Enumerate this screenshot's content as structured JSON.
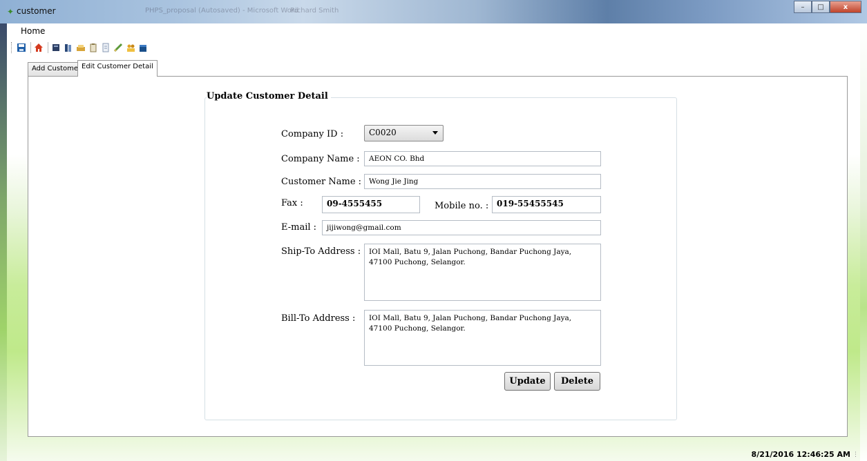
{
  "window": {
    "title": "customer",
    "blurred_taskbar_text": [
      "PHPS_proposal (Autosaved) - Microsoft Word",
      "Richard Smith"
    ],
    "buttons": {
      "minimize": "–",
      "maximize": "□",
      "close": "x"
    }
  },
  "menu": {
    "home": "Home"
  },
  "toolbar": {
    "icons": [
      "save-icon",
      "home-icon",
      "book-icon",
      "books-icon",
      "tray-icon",
      "clipboard-icon",
      "document-icon",
      "pen-icon",
      "users-icon",
      "box-icon"
    ]
  },
  "tabs": [
    {
      "label": "Add Customer",
      "active": false
    },
    {
      "label": "Edit Customer Detail",
      "active": true
    }
  ],
  "form": {
    "group_title": "Update Customer Detail",
    "company_id_label": "Company ID :",
    "company_id_value": "C0020",
    "company_name_label": "Company Name :",
    "company_name_value": "AEON CO. Bhd",
    "customer_name_label": "Customer Name :",
    "customer_name_value": "Wong Jie Jing",
    "fax_label": "Fax :",
    "fax_value": "09-4555455",
    "mobile_label": "Mobile no. :",
    "mobile_value": "019-55455545",
    "email_label": "E-mail :",
    "email_value": "jijiwong@gmail.com",
    "ship_label": "Ship-To Address :",
    "ship_value": "IOI Mall, Batu 9, Jalan Puchong, Bandar Puchong Jaya, 47100 Puchong, Selangor.",
    "bill_label": "Bill-To Address :",
    "bill_value": "IOI Mall, Batu 9, Jalan Puchong, Bandar Puchong Jaya, 47100 Puchong, Selangor.",
    "update_label": "Update",
    "delete_label": "Delete"
  },
  "status": {
    "datetime": "8/21/2016 12:46:25 AM"
  }
}
